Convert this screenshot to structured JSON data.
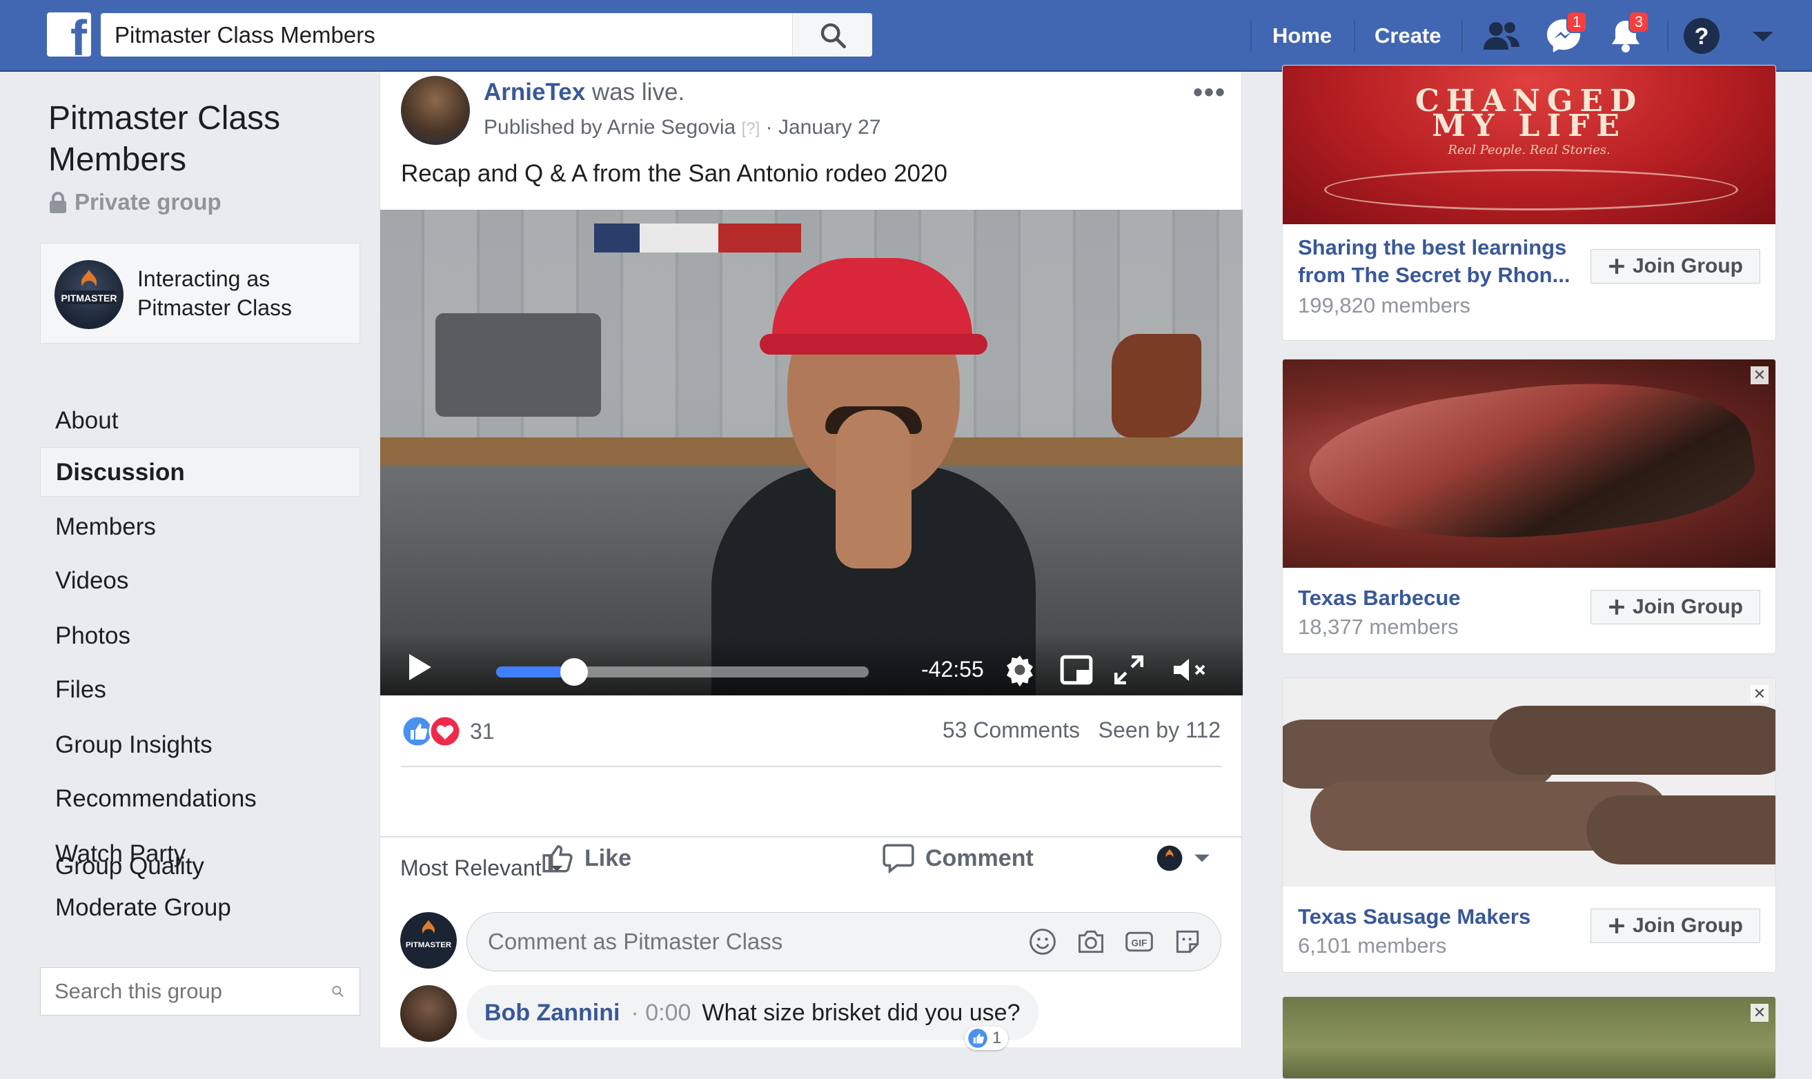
{
  "header": {
    "search_value": "Pitmaster Class Members",
    "nav_home": "Home",
    "nav_create": "Create",
    "messenger_badge": "1",
    "notifications_badge": "3",
    "brand_color": "#4267b2"
  },
  "sidebar": {
    "group_name": "Pitmaster Class Members",
    "privacy": "Private group",
    "interacting_line1": "Interacting as",
    "interacting_line2": "Pitmaster Class",
    "items": [
      {
        "label": "About"
      },
      {
        "label": "Discussion",
        "active": true
      },
      {
        "label": "Members"
      },
      {
        "label": "Videos"
      },
      {
        "label": "Photos"
      },
      {
        "label": "Files"
      },
      {
        "label": "Group Insights"
      },
      {
        "label": "Recommendations"
      },
      {
        "label": "Watch Party"
      },
      {
        "label": "Moderate Group"
      },
      {
        "label": "Group Quality"
      }
    ],
    "search_placeholder": "Search this group"
  },
  "post": {
    "author": "ArnieTex",
    "action": "was live.",
    "published_by": "Published by Arnie Segovia",
    "help_mark": "[?]",
    "date": "January 27",
    "text": "Recap and Q & A from the San Antonio rodeo 2020",
    "video": {
      "time_remaining": "-42:55",
      "progress_percent": 21
    },
    "reaction_count": "31",
    "comments_count": "53 Comments",
    "seen_by": "Seen by 112",
    "like_label": "Like",
    "comment_label": "Comment",
    "sort_label": "Most Relevant",
    "comment_placeholder": "Comment as Pitmaster Class",
    "comments": [
      {
        "author": "Bob Zannini",
        "timestamp": "0:00",
        "text": "What size brisket did you use?",
        "likes": "1"
      }
    ]
  },
  "suggested_groups": [
    {
      "image_text_1": "CHANGED",
      "image_text_2": "MY LIFE",
      "image_text_3": "Real People. Real Stories.",
      "name_line1": "Sharing the best learnings",
      "name_line2": "from The Secret by Rhon...",
      "members": "199,820 members",
      "join_label": "Join Group"
    },
    {
      "name_line1": "Texas Barbecue",
      "members": "18,377 members",
      "join_label": "Join Group"
    },
    {
      "name_line1": "Texas Sausage Makers",
      "members": "6,101 members",
      "join_label": "Join Group"
    }
  ]
}
